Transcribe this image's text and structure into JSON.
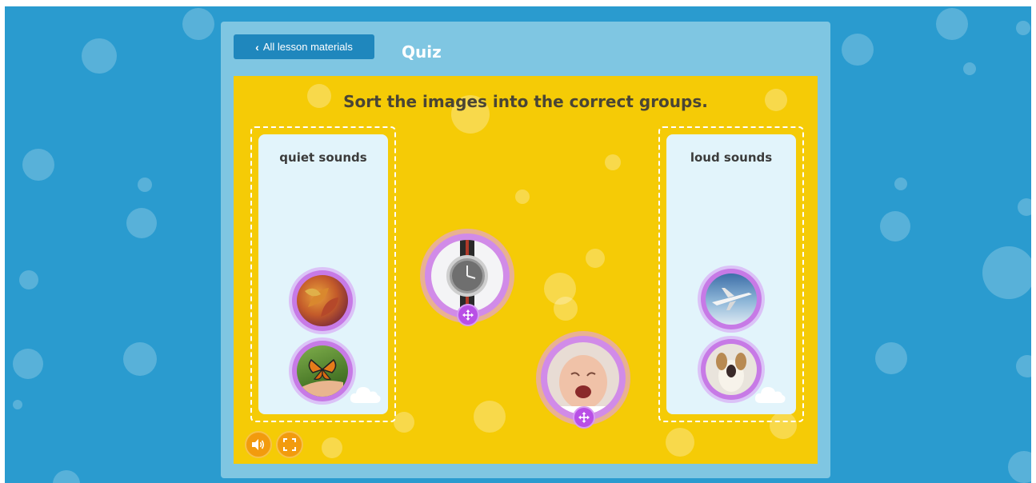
{
  "header": {
    "back_label": "All lesson materials",
    "title": "Quiz"
  },
  "activity": {
    "prompt": "Sort the images into the correct groups.",
    "groups": [
      {
        "label": "quiet sounds",
        "items": [
          "leaves-image",
          "butterfly-image"
        ]
      },
      {
        "label": "loud sounds",
        "items": [
          "airplane-image",
          "barking-dog-image"
        ]
      }
    ],
    "unsorted": [
      "wristwatch-image",
      "crying-baby-image"
    ]
  },
  "controls": {
    "sound_icon": "speaker-icon",
    "fullscreen_icon": "fullscreen-icon"
  },
  "colors": {
    "background": "#2a9bcf",
    "panel": "#7fc6e2",
    "board": "#f5cb06",
    "button": "#1f87bd",
    "token_ring": "#c77ae6",
    "control": "#f29b0e"
  }
}
